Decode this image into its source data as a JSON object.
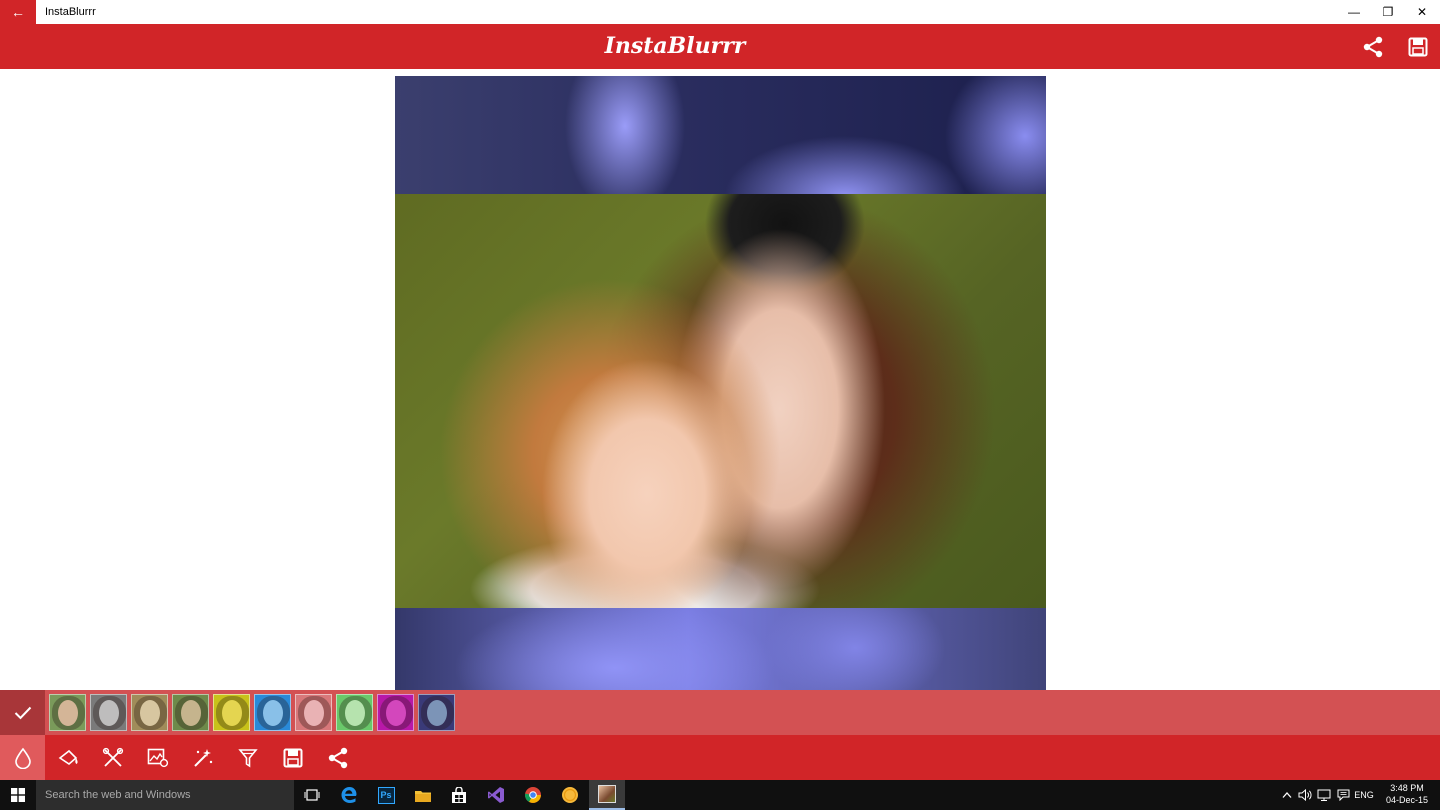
{
  "window": {
    "title": "InstaBlurrr",
    "back_glyph": "←",
    "minimize_glyph": "—",
    "restore_glyph": "❐",
    "close_glyph": "✕"
  },
  "header": {
    "logo": "InstaBlurrr",
    "actions": [
      "share-icon",
      "save-icon"
    ]
  },
  "canvas": {
    "description_icon": "edited-photo"
  },
  "filter_bar": {
    "apply_icon": "check-icon",
    "filters": [
      {
        "name": "filter-normal",
        "tint": "#7a9a5a",
        "face": "#e9c2a6"
      },
      {
        "name": "filter-grayscale",
        "tint": "#7a7a7a",
        "face": "#cfcfcf"
      },
      {
        "name": "filter-sepia",
        "tint": "#a08c5a",
        "face": "#e8d7b0"
      },
      {
        "name": "filter-vintage",
        "tint": "#6e8a4a",
        "face": "#d8c29c"
      },
      {
        "name": "filter-yellow",
        "tint": "#c8c21a",
        "face": "#f2e25a"
      },
      {
        "name": "filter-blue",
        "tint": "#2a8ad8",
        "face": "#9ad0f6"
      },
      {
        "name": "filter-pink",
        "tint": "#d8787a",
        "face": "#f6c2c4"
      },
      {
        "name": "filter-green",
        "tint": "#6ac86a",
        "face": "#c8f2c0"
      },
      {
        "name": "filter-magenta",
        "tint": "#b818a8",
        "face": "#e050c8"
      },
      {
        "name": "filter-invert",
        "tint": "#3a3a78",
        "face": "#8aa6c8"
      }
    ]
  },
  "tool_bar": {
    "tools": [
      "blur-drop-icon",
      "brush-icon",
      "tools-icon",
      "image-settings-icon",
      "magic-wand-icon",
      "filter-icon",
      "save-icon",
      "share-icon"
    ],
    "active_index": 0
  },
  "taskbar": {
    "search_placeholder": "Search the web and Windows",
    "apps": [
      "task-view-icon",
      "edge-icon",
      "photoshop-icon",
      "file-explorer-icon",
      "store-icon",
      "visual-studio-icon",
      "chrome-icon",
      "coin-app-icon",
      "instablurrr-icon"
    ],
    "photoshop_label": "Ps",
    "language": "ENG",
    "time": "3:48 PM",
    "date": "04-Dec-15"
  },
  "colors": {
    "brand_red": "#d12528",
    "filter_bar": "#d35153",
    "active_tool": "#e05a5c"
  }
}
